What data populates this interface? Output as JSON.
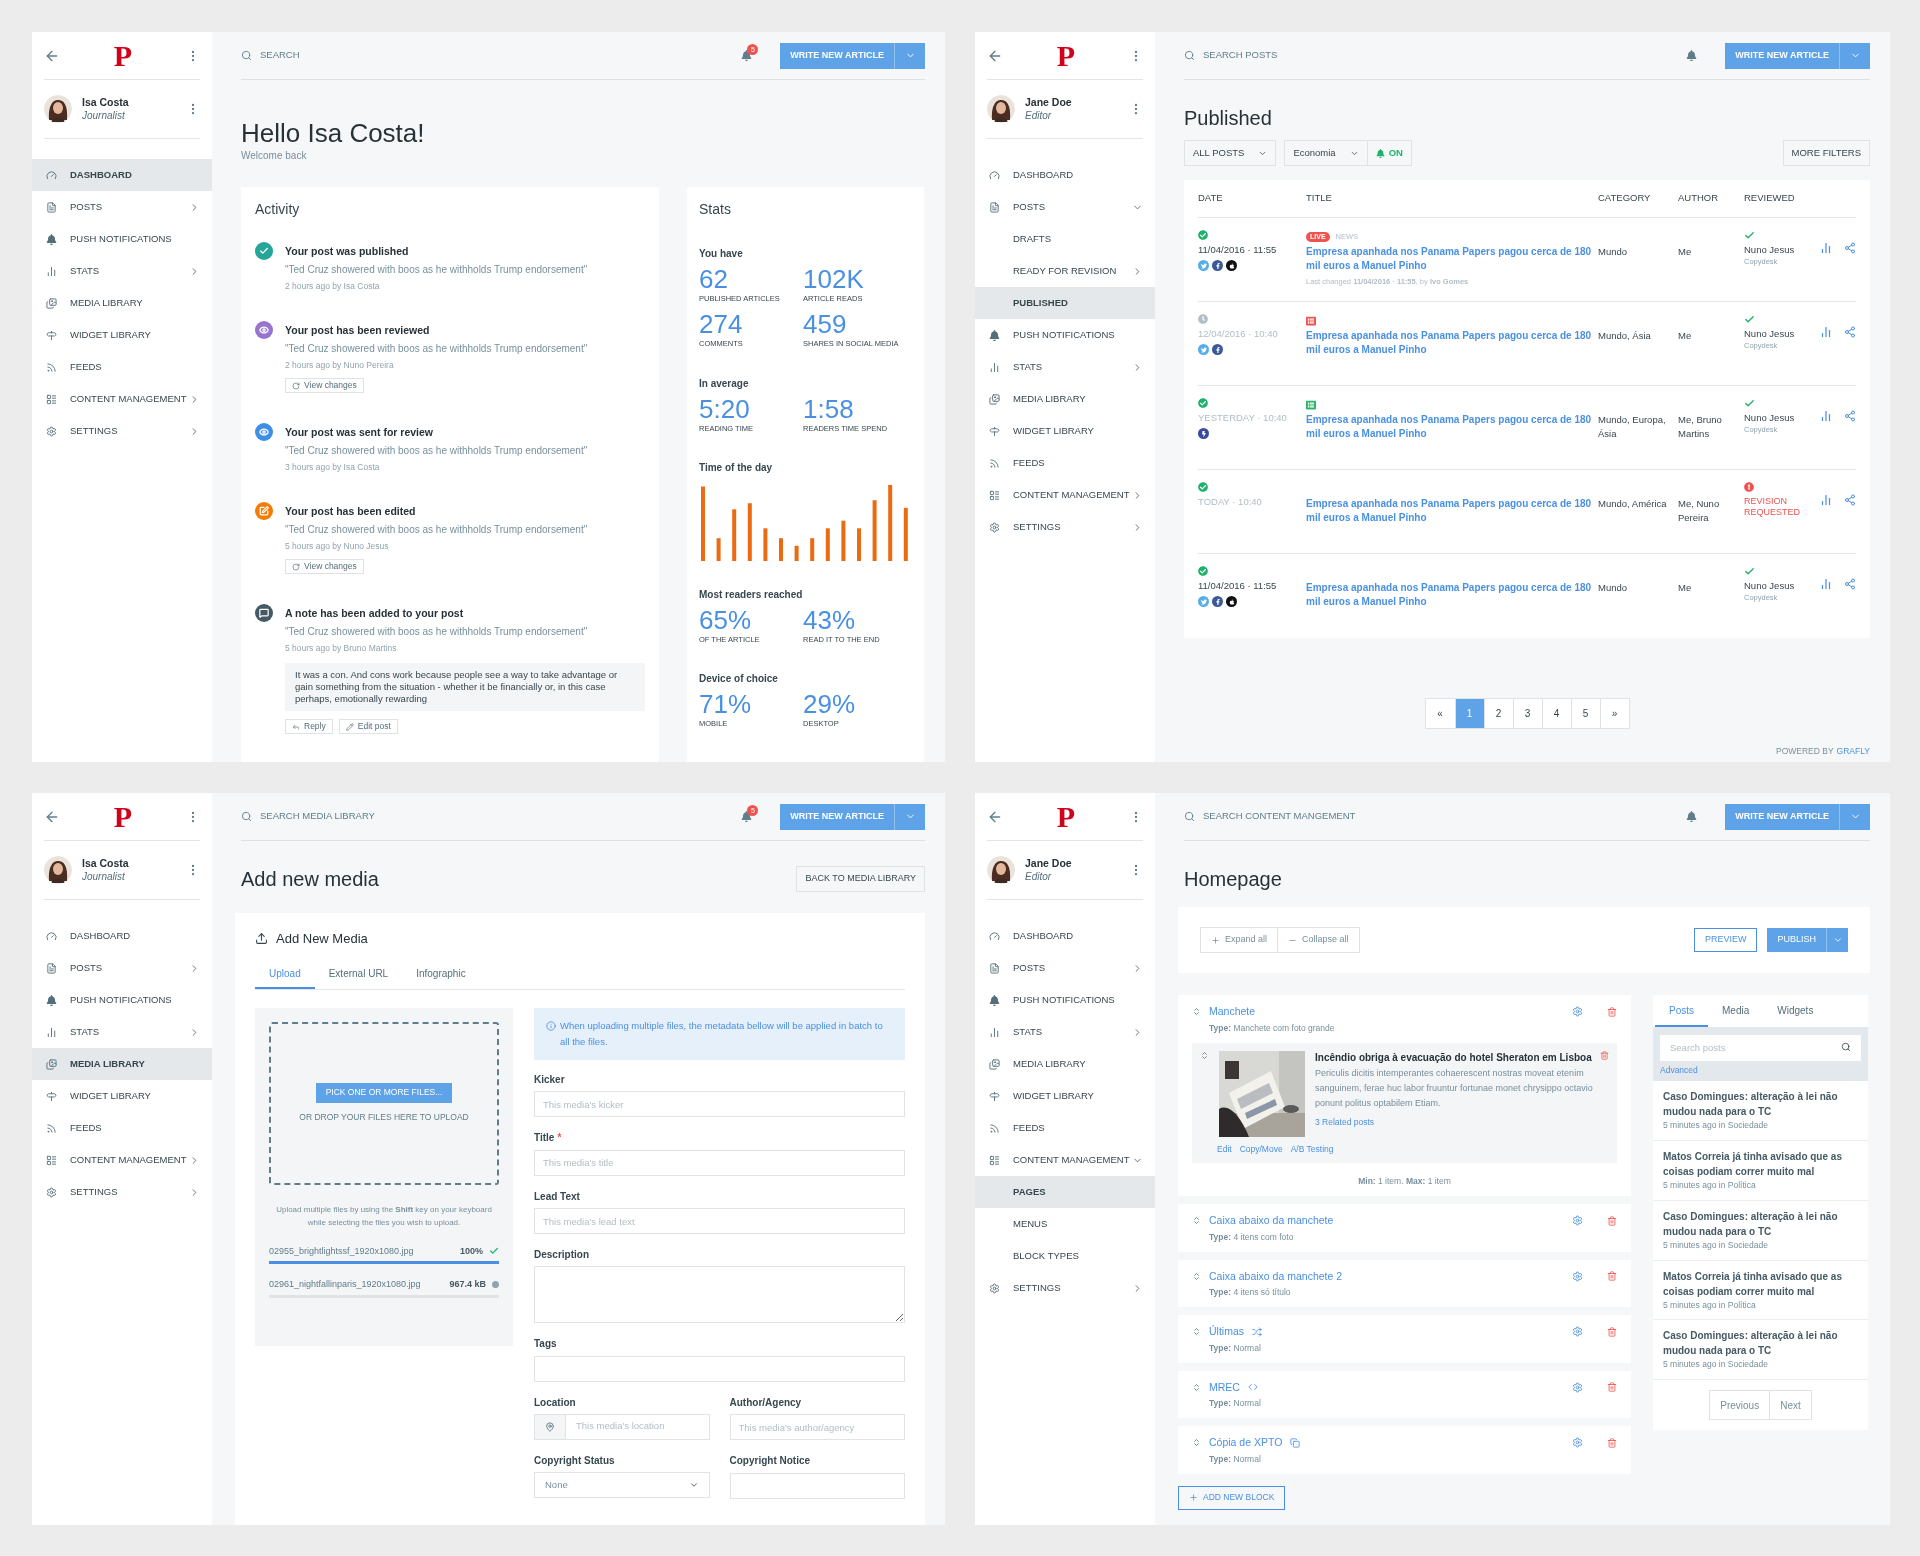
{
  "screens": [
    {
      "kind": "dashboard",
      "sidebar": {
        "logo": "P",
        "user": {
          "name": "Isa Costa",
          "role": "Journalist"
        },
        "items": [
          {
            "kind": "dashboard",
            "label": "DASHBOARD",
            "selected": true
          },
          {
            "kind": "posts",
            "label": "POSTS",
            "selected": false,
            "expanded": false
          },
          {
            "kind": "push",
            "label": "PUSH NOTIFICATIONS",
            "selected": false
          },
          {
            "kind": "stats",
            "label": "STATS",
            "selected": false,
            "expanded": false
          },
          {
            "kind": "media",
            "label": "MEDIA LIBRARY",
            "selected": false
          },
          {
            "kind": "widget",
            "label": "WIDGET LIBRARY",
            "selected": false
          },
          {
            "kind": "feeds",
            "label": "FEEDS",
            "selected": false
          },
          {
            "kind": "content",
            "label": "CONTENT MANAGEMENT",
            "selected": false,
            "expanded": false
          },
          {
            "kind": "settings",
            "label": "SETTINGS",
            "selected": false,
            "expanded": false
          }
        ]
      },
      "topbar": {
        "placeholder": "SEARCH",
        "badge": "5",
        "button": "WRITE NEW ARTICLE"
      },
      "title": "Hello Isa Costa!",
      "subtitle": "Welcome back",
      "activity": {
        "title": "Activity",
        "items": [
          {
            "kind": "published",
            "color": "#26a69a",
            "title": "Your post was published",
            "quote": "\"Ted Cruz showered with boos as he withholds Trump endorsement\"",
            "meta": "2 hours ago by Isa Costa"
          },
          {
            "kind": "reviewed",
            "color": "#9575cd",
            "title": "Your post has been reviewed",
            "quote": "\"Ted Cruz showered with boos as he withholds Trump endorsement\"",
            "meta": "2 hours ago by Nuno Pereira",
            "actions": [
              {
                "kind": "changes",
                "label": "View changes"
              }
            ]
          },
          {
            "kind": "sent",
            "color": "#3f8fe8",
            "title": "Your post was sent for review",
            "quote": "\"Ted Cruz showered with boos as he withholds Trump endorsement\"",
            "meta": "3 hours ago by Isa Costa"
          },
          {
            "kind": "edited",
            "color": "#f57c00",
            "title": "Your post has been edited",
            "quote": "\"Ted Cruz showered with boos as he withholds Trump endorsement\"",
            "meta": "5 hours ago by Nuno Jesus",
            "actions": [
              {
                "kind": "changes",
                "label": "View changes"
              }
            ]
          },
          {
            "kind": "note",
            "color": "#455a64",
            "title": "A note has been added to your post",
            "quote": "\"Ted Cruz showered with boos as he withholds Trump endorsement\"",
            "meta": "5 hours ago by Bruno Martins",
            "note": "It was a con. And cons work because people see a way to take advantage or gain something from the situation - whether it be financially or, in this case perhaps, emotionally rewarding",
            "actions": [
              {
                "kind": "reply",
                "label": "Reply"
              },
              {
                "kind": "edit",
                "label": "Edit post"
              }
            ]
          }
        ]
      },
      "stats": {
        "title": "Stats",
        "groups": [
          {
            "kind": "metrics",
            "heading": "You have",
            "metrics": [
              {
                "value": "62",
                "label": "PUBLISHED ARTICLES"
              },
              {
                "value": "102K",
                "label": "ARTICLE READS"
              },
              {
                "value": "274",
                "label": "COMMENTS"
              },
              {
                "value": "459",
                "label": "SHARES IN SOCIAL MEDIA"
              }
            ]
          },
          {
            "kind": "metrics",
            "heading": "In average",
            "metrics": [
              {
                "value": "5:20",
                "label": "READING TIME"
              },
              {
                "value": "1:58",
                "label": "READERS TIME SPEND"
              }
            ]
          },
          {
            "kind": "chart",
            "heading": "Time of the day"
          },
          {
            "kind": "metrics",
            "heading": "Most readers reached",
            "metrics": [
              {
                "value": "65%",
                "label": "OF THE ARTICLE"
              },
              {
                "value": "43%",
                "label": "READ IT TO THE END"
              }
            ]
          },
          {
            "kind": "metrics",
            "heading": "Device of choice",
            "metrics": [
              {
                "value": "71%",
                "label": "MOBILE"
              },
              {
                "value": "29%",
                "label": "DESKTOP"
              }
            ]
          }
        ]
      }
    },
    {
      "kind": "posts",
      "sidebar": {
        "logo": "P",
        "user": {
          "name": "Jane Doe",
          "role": "Editor"
        },
        "items": [
          {
            "kind": "dashboard",
            "label": "DASHBOARD",
            "selected": false
          },
          {
            "kind": "posts",
            "label": "POSTS",
            "selected": false,
            "expanded": true,
            "children": [
              {
                "label": "DRAFTS",
                "selected": false
              },
              {
                "label": "READY FOR REVISION",
                "selected": false,
                "expanded": false
              },
              {
                "label": "PUBLISHED",
                "selected": true
              }
            ]
          },
          {
            "kind": "push",
            "label": "PUSH NOTIFICATIONS",
            "selected": false
          },
          {
            "kind": "stats",
            "label": "STATS",
            "selected": false,
            "expanded": false
          },
          {
            "kind": "media",
            "label": "MEDIA LIBRARY",
            "selected": false
          },
          {
            "kind": "widget",
            "label": "WIDGET LIBRARY",
            "selected": false
          },
          {
            "kind": "feeds",
            "label": "FEEDS",
            "selected": false
          },
          {
            "kind": "content",
            "label": "CONTENT MANAGEMENT",
            "selected": false,
            "expanded": false
          },
          {
            "kind": "settings",
            "label": "SETTINGS",
            "selected": false,
            "expanded": false
          }
        ]
      },
      "topbar": {
        "placeholder": "SEARCH POSTS",
        "button": "WRITE NEW ARTICLE"
      },
      "title": "Published",
      "filters": [
        {
          "kind": "select",
          "label": "ALL POSTS"
        },
        {
          "kind": "select",
          "label": "Economia"
        },
        {
          "kind": "toggle",
          "label": "ON",
          "on": true
        }
      ],
      "more_filters": "MORE FILTERS",
      "table": {
        "columns": [
          "DATE",
          "TITLE",
          "CATEGORY",
          "AUTHOR",
          "REVIEWED"
        ],
        "rows": [
          {
            "kind": "published",
            "date": "11/04/2016 · 11:55",
            "muted": false,
            "social": [
              {
                "kind": "bird"
              },
              {
                "kind": "f"
              },
              {
                "kind": "apple"
              }
            ],
            "marker": {
              "kind": "live",
              "label": "LIVE",
              "section": "NEWS"
            },
            "title": "Empresa apanhada nos Panama Papers pagou cerca de 180 mil euros a Manuel Pinho",
            "changed": "Last changed **11/04/2016** · **11:55**, by **Ivo Gomes**",
            "category": "Mundo",
            "author": "Me",
            "review": {
              "kind": "ok",
              "name": "Nuno Jesus",
              "desk": "Copydesk"
            }
          },
          {
            "kind": "scheduled",
            "date": "12/04/2016 · 10:40",
            "muted": true,
            "social": [
              {
                "kind": "bird"
              },
              {
                "kind": "f"
              }
            ],
            "marker": {
              "kind": "doc",
              "color": "#ef5350"
            },
            "title": "Empresa apanhada nos Panama Papers pagou cerca de 180 mil euros a Manuel Pinho",
            "category": "Mundo, Ásia",
            "author": "Me",
            "review": {
              "kind": "ok",
              "name": "Nuno Jesus",
              "desk": "Copydesk"
            }
          },
          {
            "kind": "published",
            "date": "YESTERDAY · 10:40",
            "muted": true,
            "social": [
              {
                "kind": "bolt"
              }
            ],
            "marker": {
              "kind": "doc",
              "color": "#26b36b"
            },
            "title": "Empresa apanhada nos Panama Papers pagou cerca de 180 mil euros a Manuel Pinho",
            "category": "Mundo, Europa, Ásia",
            "author": "Me, Bruno Martins",
            "review": {
              "kind": "ok",
              "name": "Nuno Jesus",
              "desk": "Copydesk"
            }
          },
          {
            "kind": "published",
            "date": "TODAY · 10:40",
            "muted": true,
            "title": "Empresa apanhada nos Panama Papers pagou cerca de 180 mil euros a Manuel Pinho",
            "category": "Mundo, América",
            "author": "Me, Nuno Pereira",
            "review": {
              "kind": "revision",
              "label": "REVISION REQUESTED"
            }
          },
          {
            "kind": "published",
            "date": "11/04/2016 · 11:55",
            "muted": false,
            "social": [
              {
                "kind": "bird"
              },
              {
                "kind": "f"
              },
              {
                "kind": "apple"
              }
            ],
            "title": "Empresa apanhada nos Panama Papers pagou cerca de 180 mil euros a Manuel Pinho",
            "category": "Mundo",
            "author": "Me",
            "review": {
              "kind": "ok",
              "name": "Nuno Jesus",
              "desk": "Copydesk"
            }
          }
        ]
      },
      "pagination": [
        {
          "label": "«",
          "selected": false
        },
        {
          "label": "1",
          "selected": true
        },
        {
          "label": "2",
          "selected": false
        },
        {
          "label": "3",
          "selected": false
        },
        {
          "label": "4",
          "selected": false
        },
        {
          "label": "5",
          "selected": false
        },
        {
          "label": "»",
          "selected": false
        }
      ],
      "footer": {
        "text": "POWERED BY",
        "link": "GRAFLY"
      }
    },
    {
      "kind": "media",
      "sidebar": {
        "logo": "P",
        "user": {
          "name": "Isa Costa",
          "role": "Journalist"
        },
        "items": [
          {
            "kind": "dashboard",
            "label": "DASHBOARD",
            "selected": false
          },
          {
            "kind": "posts",
            "label": "POSTS",
            "selected": false,
            "expanded": false
          },
          {
            "kind": "push",
            "label": "PUSH NOTIFICATIONS",
            "selected": false
          },
          {
            "kind": "stats",
            "label": "STATS",
            "selected": false,
            "expanded": false
          },
          {
            "kind": "media",
            "label": "MEDIA LIBRARY",
            "selected": true
          },
          {
            "kind": "widget",
            "label": "WIDGET LIBRARY",
            "selected": false
          },
          {
            "kind": "feeds",
            "label": "FEEDS",
            "selected": false
          },
          {
            "kind": "content",
            "label": "CONTENT MANAGEMENT",
            "selected": false,
            "expanded": false
          },
          {
            "kind": "settings",
            "label": "SETTINGS",
            "selected": false,
            "expanded": false
          }
        ]
      },
      "topbar": {
        "placeholder": "SEARCH MEDIA LIBRARY",
        "badge": "5",
        "button": "WRITE NEW ARTICLE"
      },
      "title": "Add new media",
      "back": "BACK TO MEDIA LIBRARY",
      "card": {
        "heading": "Add New Media",
        "tabs": [
          {
            "label": "Upload",
            "selected": true
          },
          {
            "label": "External URL",
            "selected": false
          },
          {
            "label": "Infographic",
            "selected": false
          }
        ],
        "upload": {
          "button": "PICK ONE OR MORE FILES...",
          "drop": "OR DROP YOUR FILES HERE TO UPLOAD",
          "hint": "Upload multiple files by using the **Shift** key on your keyboard while selecting the files you wish to upload.",
          "files": [
            {
              "name": "02955_brightlightssf_1920x1080.jpg",
              "reading": "100%",
              "level": 1,
              "done": true
            },
            {
              "name": "02961_nightfallinparis_1920x1080.jpg",
              "reading": "967.4 kB",
              "level": 0,
              "done": false
            }
          ]
        },
        "info": "When uploading multiple files, the metadata bellow will be applied in batch to all the files.",
        "fields": [
          {
            "kind": "text",
            "label": "Kicker",
            "placeholder": "This media's kicker"
          },
          {
            "kind": "text",
            "label": "Title",
            "required_mark": "*",
            "placeholder": "This media's title"
          },
          {
            "kind": "text",
            "label": "Lead Text",
            "placeholder": "This media's lead text"
          },
          {
            "kind": "textarea",
            "label": "Description"
          },
          {
            "kind": "text",
            "label": "Tags"
          },
          {
            "kind": "pair",
            "fields": [
              {
                "kind": "location",
                "label": "Location",
                "placeholder": "This media's location"
              },
              {
                "kind": "text",
                "label": "Author/Agency",
                "placeholder": "This media's author/agency"
              }
            ]
          },
          {
            "kind": "pair",
            "fields": [
              {
                "kind": "select",
                "label": "Copyright Status",
                "value": "None"
              },
              {
                "kind": "text",
                "label": "Copyright Notice"
              }
            ]
          }
        ]
      }
    },
    {
      "kind": "pages",
      "sidebar": {
        "logo": "P",
        "user": {
          "name": "Jane Doe",
          "role": "Editor"
        },
        "items": [
          {
            "kind": "dashboard",
            "label": "DASHBOARD",
            "selected": false
          },
          {
            "kind": "posts",
            "label": "POSTS",
            "selected": false,
            "expanded": false
          },
          {
            "kind": "push",
            "label": "PUSH NOTIFICATIONS",
            "selected": false
          },
          {
            "kind": "stats",
            "label": "STATS",
            "selected": false,
            "expanded": false
          },
          {
            "kind": "media",
            "label": "MEDIA LIBRARY",
            "selected": false
          },
          {
            "kind": "widget",
            "label": "WIDGET LIBRARY",
            "selected": false
          },
          {
            "kind": "feeds",
            "label": "FEEDS",
            "selected": false
          },
          {
            "kind": "content",
            "label": "CONTENT MANAGEMENT",
            "selected": false,
            "expanded": true,
            "children": [
              {
                "label": "PAGES",
                "selected": true
              },
              {
                "label": "MENUS",
                "selected": false
              },
              {
                "label": "BLOCK TYPES",
                "selected": false
              }
            ]
          },
          {
            "kind": "settings",
            "label": "SETTINGS",
            "selected": false,
            "expanded": false
          }
        ]
      },
      "topbar": {
        "placeholder": "SEARCH CONTENT MANGEMENT",
        "button": "WRITE NEW ARTICLE"
      },
      "title": "Homepage",
      "toolbar": {
        "expand": "Expand all",
        "collapse": "Collapse all",
        "preview": "PREVIEW",
        "publish": "PUBLISH"
      },
      "blocks": [
        {
          "title": "Manchete",
          "type": "**Type:** Manchete com foto grande",
          "post": {
            "title": "Incêndio obriga à evacuação do hotel Sheraton em Lisboa",
            "body": "Periculis dicitis intemperantes cohaerescent nostras moveat etenim sanguinem, ferae huc labor fruuntur fortunae monet chrysippo octavio ponunt politus optabilem Etiam.",
            "related": "3 Related posts",
            "actions": [
              "Edit",
              "Copy/Move",
              "A/B Testing"
            ]
          },
          "limits": "**Min:** 1 item. **Max:** 1 item"
        },
        {
          "title": "Caixa abaixo da manchete",
          "type": "**Type:** 4 itens com foto"
        },
        {
          "title": "Caixa abaixo da manchete 2",
          "type": "**Type:** 4 itens só título"
        },
        {
          "title": "Últimas",
          "badge": {
            "kind": "shuffle"
          },
          "type": "**Type:** Normal"
        },
        {
          "title": "MREC",
          "badge": {
            "kind": "code"
          },
          "type": "**Type:** Normal"
        },
        {
          "title": "Cópia de XPTO",
          "badge": {
            "kind": "copy"
          },
          "type": "**Type:** Normal"
        }
      ],
      "add_block": "ADD NEW BLOCK",
      "library": {
        "tabs": [
          {
            "label": "Posts",
            "selected": true
          },
          {
            "label": "Media",
            "selected": false
          },
          {
            "label": "Widgets",
            "selected": false
          }
        ],
        "placeholder": "Search posts",
        "advanced": "Advanced",
        "posts": [
          {
            "title": "Caso Domingues: alteração à lei não mudou nada para o TC",
            "meta": "5 minutes ago in Sociedade"
          },
          {
            "title": "Matos Correia já tinha avisado que as coisas podiam correr muito mal",
            "meta": "5 minutes ago in Política"
          },
          {
            "title": "Caso Domingues: alteração à lei não mudou nada para o TC",
            "meta": "5 minutes ago in Sociedade"
          },
          {
            "title": "Matos Correia já tinha avisado que as coisas podiam correr muito mal",
            "meta": "5 minutes ago in Política"
          },
          {
            "title": "Caso Domingues: alteração à lei não mudou nada para o TC",
            "meta": "5 minutes ago in Sociedade"
          }
        ],
        "pager": [
          "Previous",
          "Next"
        ]
      }
    }
  ]
}
